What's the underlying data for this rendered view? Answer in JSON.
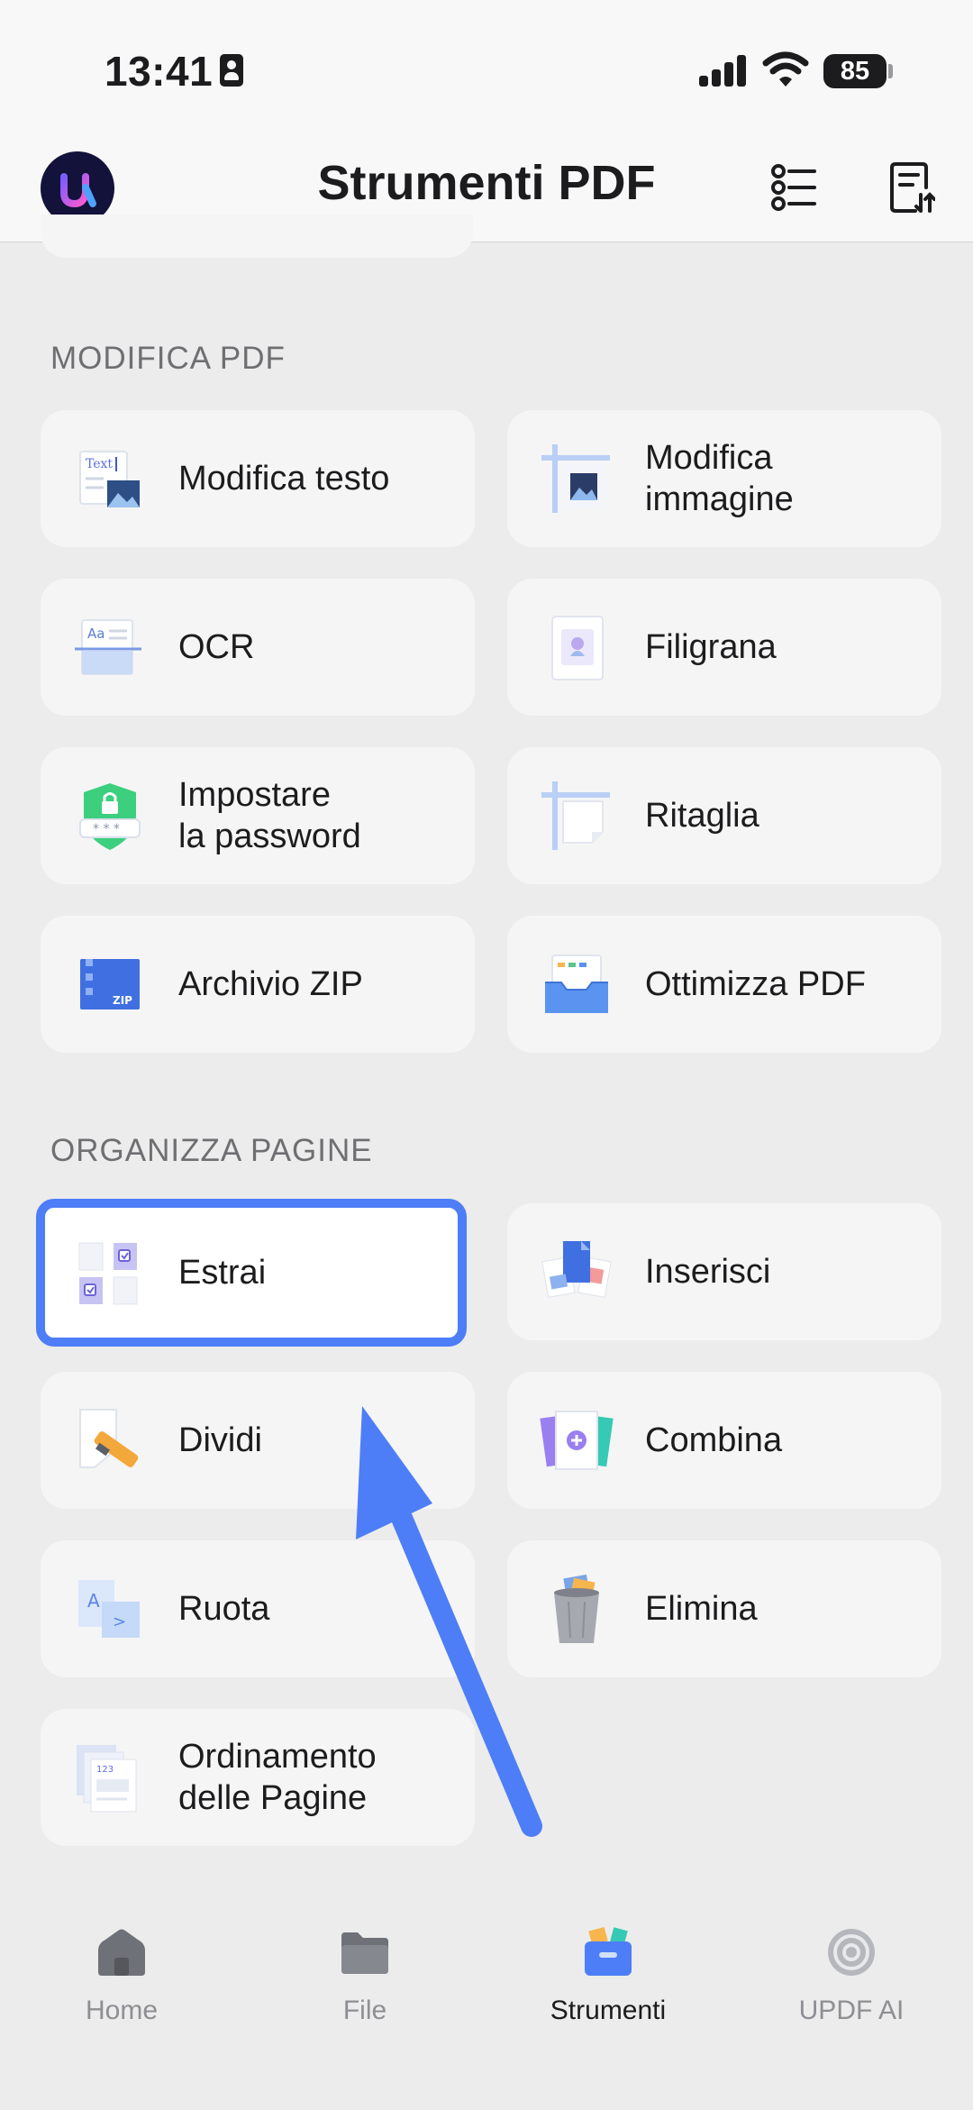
{
  "status_bar": {
    "time": "13:41",
    "battery": "85"
  },
  "header": {
    "title": "Strumenti PDF"
  },
  "sections": [
    {
      "title": "MODIFICA PDF",
      "items": [
        {
          "label": "Modifica testo",
          "icon": "edit-text-icon"
        },
        {
          "label": "Modifica\nimmagine",
          "icon": "edit-image-icon"
        },
        {
          "label": "OCR",
          "icon": "ocr-icon"
        },
        {
          "label": "Filigrana",
          "icon": "watermark-icon"
        },
        {
          "label": "Impostare\nla password",
          "icon": "password-shield-icon"
        },
        {
          "label": "Ritaglia",
          "icon": "crop-icon"
        },
        {
          "label": "Archivio ZIP",
          "icon": "zip-archive-icon"
        },
        {
          "label": "Ottimizza PDF",
          "icon": "optimize-tray-icon"
        }
      ]
    },
    {
      "title": "ORGANIZZA PAGINE",
      "items": [
        {
          "label": "Estrai",
          "icon": "extract-pages-icon",
          "highlighted": true
        },
        {
          "label": "Inserisci",
          "icon": "insert-pages-icon"
        },
        {
          "label": "Dividi",
          "icon": "split-cutter-icon"
        },
        {
          "label": "Combina",
          "icon": "combine-icon"
        },
        {
          "label": "Ruota",
          "icon": "rotate-icon"
        },
        {
          "label": "Elimina",
          "icon": "trash-icon"
        },
        {
          "label": "Ordinamento\ndelle Pagine",
          "icon": "page-order-icon"
        }
      ]
    }
  ],
  "bottom_nav": [
    {
      "label": "Home",
      "icon": "home-icon"
    },
    {
      "label": "File",
      "icon": "folder-icon"
    },
    {
      "label": "Strumenti",
      "icon": "toolbox-icon",
      "active": true
    },
    {
      "label": "UPDF AI",
      "icon": "ai-icon"
    }
  ],
  "colors": {
    "highlight": "#4d7ef7",
    "card": "#f5f5f5",
    "background": "#ececec"
  }
}
